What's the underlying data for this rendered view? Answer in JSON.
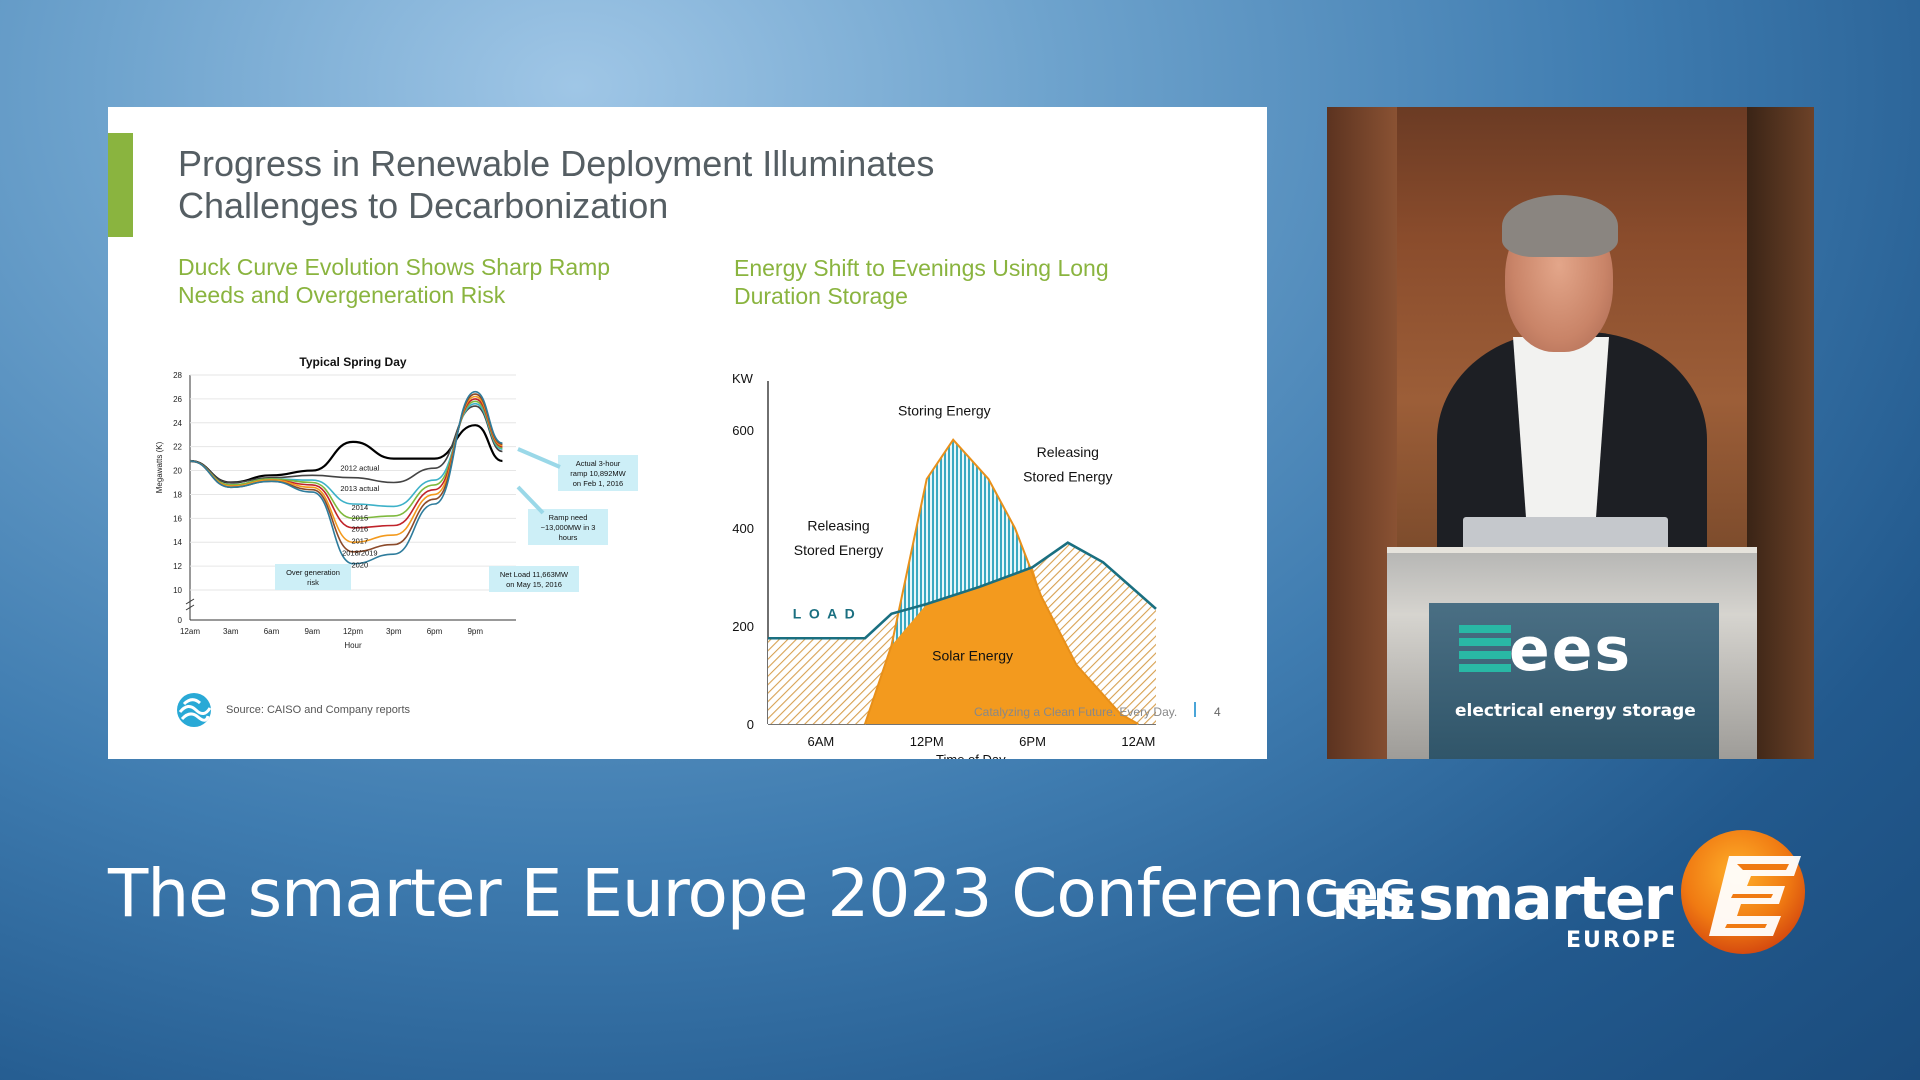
{
  "slide": {
    "title_line1": "Progress in Renewable Deployment Illuminates",
    "title_line2": "Challenges to Decarbonization",
    "left_heading_line1": "Duck Curve Evolution Shows Sharp Ramp",
    "left_heading_line2": "Needs and Overgeneration Risk",
    "right_heading_line1": "Energy Shift to Evenings Using Long",
    "right_heading_line2": "Duration Storage",
    "footer_source": "Source: CAISO and Company reports",
    "footer_tagline": "Catalyzing a Clean Future. Every Day.",
    "footer_page": "4"
  },
  "chart_data": [
    {
      "type": "line",
      "title": "Typical Spring Day",
      "xlabel": "Hour",
      "ylabel": "Megawatts (K)",
      "ylim": [
        0,
        28
      ],
      "yticks": [
        "0",
        "10",
        "12",
        "14",
        "16",
        "18",
        "20",
        "22",
        "24",
        "26",
        "28"
      ],
      "categories": [
        "12am",
        "3am",
        "6am",
        "9am",
        "12pm",
        "3pm",
        "6pm",
        "9pm"
      ],
      "x": [
        0,
        3,
        6,
        9,
        12,
        15,
        18,
        21,
        23
      ],
      "series": [
        {
          "name": "2012 actual",
          "color": "#000000",
          "values": [
            20.8,
            19.0,
            19.6,
            20.0,
            22.4,
            21.0,
            21.0,
            23.8,
            20.8
          ]
        },
        {
          "name": "2013 actual",
          "color": "#444444",
          "values": [
            20.8,
            19.0,
            19.4,
            19.6,
            19.4,
            19.0,
            20.2,
            25.4,
            21.6
          ]
        },
        {
          "name": "2014",
          "color": "#3db1c8",
          "values": [
            20.8,
            18.8,
            19.3,
            19.2,
            17.2,
            17.0,
            19.2,
            25.6,
            21.8
          ]
        },
        {
          "name": "2015",
          "color": "#7fb93e",
          "values": [
            20.8,
            18.8,
            19.3,
            19.0,
            16.0,
            16.2,
            18.8,
            25.8,
            21.9
          ]
        },
        {
          "name": "2016",
          "color": "#c0232a",
          "values": [
            20.8,
            18.7,
            19.2,
            18.8,
            15.2,
            15.4,
            18.4,
            26.0,
            22.0
          ]
        },
        {
          "name": "2017",
          "color": "#f39a1e",
          "values": [
            20.8,
            18.7,
            19.2,
            18.6,
            14.0,
            14.6,
            18.0,
            26.2,
            22.1
          ]
        },
        {
          "name": "2018/2019",
          "color": "#8b4a2a",
          "values": [
            20.8,
            18.6,
            19.1,
            18.4,
            13.2,
            13.8,
            17.6,
            26.4,
            22.2
          ]
        },
        {
          "name": "2020",
          "color": "#2e7c9c",
          "values": [
            20.8,
            18.6,
            19.1,
            18.2,
            12.2,
            13.0,
            17.2,
            26.6,
            22.3
          ]
        }
      ],
      "series_labels": [
        "2012 actual",
        "2013 actual",
        "2014",
        "2015",
        "2016",
        "2017",
        "2018/2019",
        "2020"
      ],
      "annotations": {
        "actual_ramp": [
          "Actual 3-hour",
          "ramp 10,892MW",
          "on Feb 1, 2016"
        ],
        "ramp_need": [
          "Ramp need",
          "~13,000MW in 3",
          "hours"
        ],
        "net_load": [
          "Net Load 11,663MW",
          "on May 15, 2016"
        ],
        "overgen": [
          "Over generation",
          "risk"
        ]
      }
    },
    {
      "type": "area",
      "ylabel": "KW",
      "xlabel": "Time of Day",
      "yticks": [
        "0",
        "200",
        "400",
        "600"
      ],
      "xticks": [
        "6AM",
        "12PM",
        "6PM",
        "12AM"
      ],
      "ylim": [
        0,
        700
      ],
      "load_label": "L O A D",
      "regions": {
        "releasing_left": [
          "Releasing",
          "Stored Energy"
        ],
        "storing": "Storing Energy",
        "releasing_right": [
          "Releasing",
          "Stored Energy"
        ],
        "solar": "Solar Energy"
      },
      "colors": {
        "solar": "#f39a1e",
        "load": "#1a6f80",
        "storing": "#3aa9c1",
        "releasing": "#d7a050"
      }
    }
  ],
  "conference": {
    "title": "The smarter E Europe 2023 Conferences"
  },
  "video": {
    "podium_logo": "ees",
    "podium_caption": "electrical energy storage"
  },
  "brand": {
    "the": "THE",
    "smarter": "smarter",
    "europe": "EUROPE",
    "letter": "E"
  }
}
